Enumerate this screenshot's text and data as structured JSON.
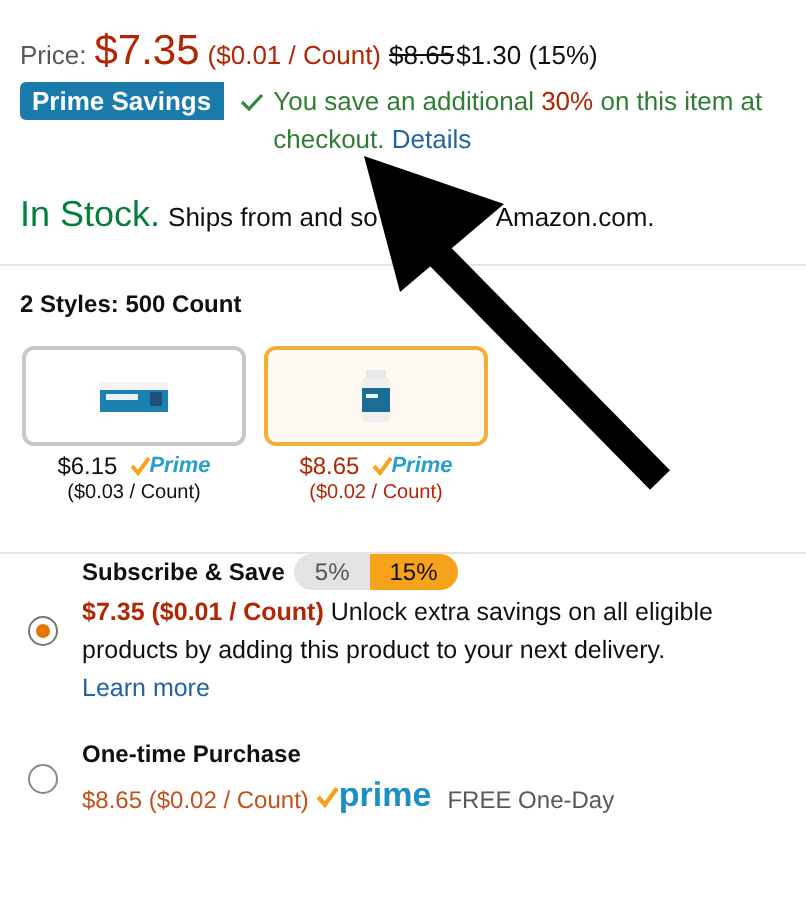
{
  "price": {
    "label": "Price:",
    "amount": "$7.35",
    "per_unit": "($0.01 / Count)",
    "list_price": "$8.65",
    "savings": "$1.30 (15%)"
  },
  "prime_savings": {
    "badge": "Prime Savings",
    "before": "You save an additional",
    "highlight": "30%",
    "after": "on this item at checkout.",
    "link": "Details"
  },
  "stock": {
    "status": "In Stock.",
    "shipping_start": "Ships from and so",
    "shipping_end": "Amazon.com."
  },
  "styles": {
    "heading": "2 Styles: 500 Count",
    "options": [
      {
        "price": "$6.15",
        "prime": "Prime",
        "per_unit": "($0.03 / Count)",
        "selected": false
      },
      {
        "price": "$8.65",
        "prime": "Prime",
        "per_unit": "($0.02 / Count)",
        "selected": true
      }
    ]
  },
  "purchase_options": [
    {
      "kind": "subscribe",
      "title": "Subscribe & Save",
      "selected": true,
      "tiers": [
        {
          "label": "5%",
          "selected": false
        },
        {
          "label": "15%",
          "selected": true
        }
      ],
      "price": "$7.35 ($0.01 / Count)",
      "description": "Unlock extra savings on all eligible products by adding this product to your next delivery.",
      "link": "Learn more"
    },
    {
      "kind": "one_time",
      "title": "One-time Purchase",
      "selected": false,
      "price": "$8.65 ($0.02 / Count)",
      "prime": "prime",
      "delivery": "FREE One-Day"
    }
  ]
}
